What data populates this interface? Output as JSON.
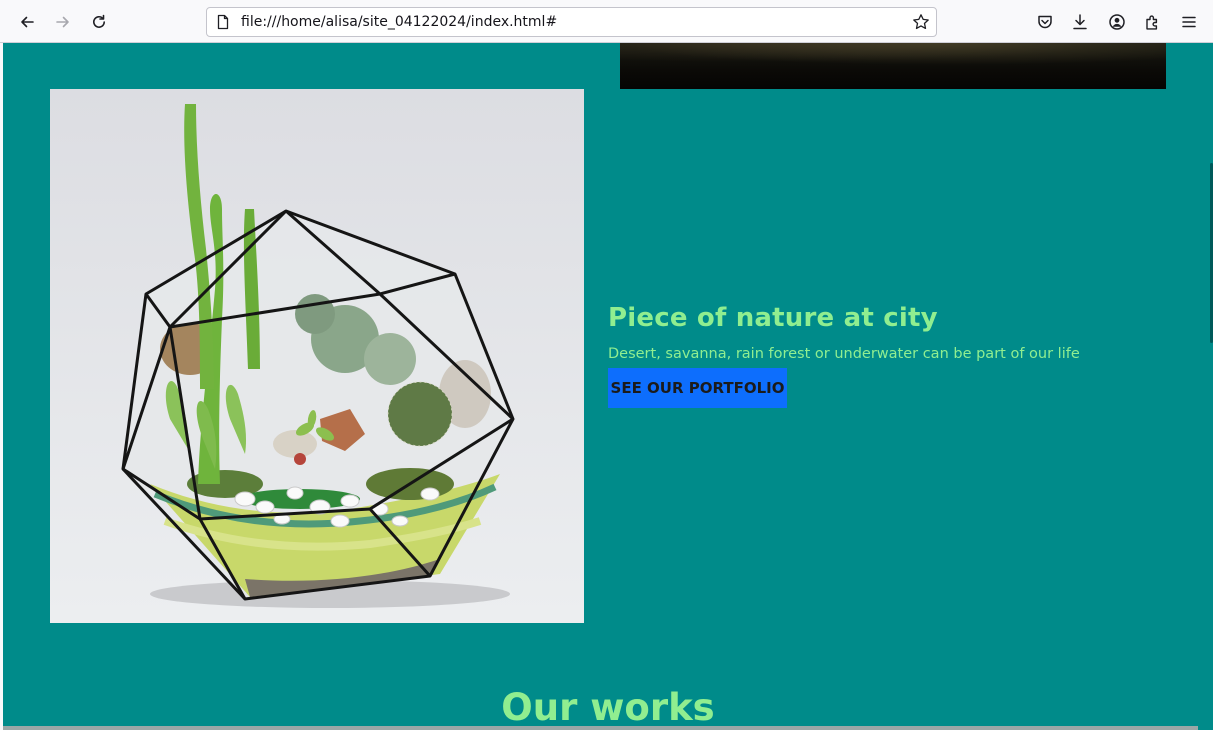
{
  "browser": {
    "url": "file:///home/alisa/site_04122024/index.html#",
    "icons": {
      "back": "back-arrow-icon",
      "forward": "forward-arrow-icon",
      "reload": "reload-icon",
      "page": "page-icon",
      "bookmark": "star-icon",
      "pocket": "pocket-icon",
      "downloads": "download-icon",
      "account": "account-icon",
      "extensions": "extensions-icon",
      "menu": "hamburger-menu-icon"
    }
  },
  "hero": {
    "title": "Piece of nature at city",
    "subtitle": "Desert, savanna, rain forest or underwater can be part of our life",
    "button_label": "SEE OUR PORTFOLIO"
  },
  "works": {
    "title": "Our works"
  },
  "colors": {
    "page_background": "#008b8a",
    "accent_text": "#90ee90",
    "button_background": "#0d6efd"
  }
}
